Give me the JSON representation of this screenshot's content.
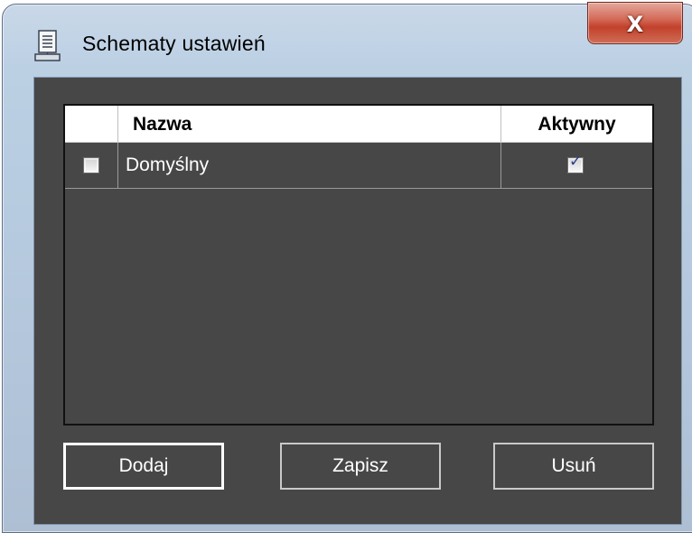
{
  "window": {
    "title": "Schematy ustawień",
    "title_icon": "document-computer-icon",
    "close_icon": "close-icon",
    "close_label": "X"
  },
  "grid": {
    "columns": [
      {
        "label": ""
      },
      {
        "label": "Nazwa"
      },
      {
        "label": "Aktywny"
      }
    ],
    "rows": [
      {
        "selected": false,
        "name": "Domyślny",
        "active": true
      }
    ]
  },
  "buttons": {
    "add_label": "Dodaj",
    "save_label": "Zapisz",
    "delete_label": "Usuń"
  },
  "colors": {
    "client_background": "#474747",
    "close_button": "#c2412c",
    "checkmark": "#2b3b8f"
  }
}
